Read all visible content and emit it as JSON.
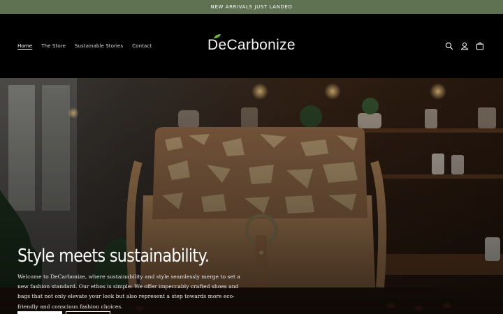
{
  "announcement": {
    "text": "NEW ARRIVALS JUST LANDED"
  },
  "header": {
    "nav": [
      {
        "label": "Home",
        "active": true
      },
      {
        "label": "The Store"
      },
      {
        "label": "Sustainable Stories"
      },
      {
        "label": "Contact"
      }
    ],
    "logo": {
      "part1": "De",
      "part2": "Carbonize"
    },
    "icons": [
      "search-icon",
      "account-icon",
      "cart-icon"
    ]
  },
  "hero": {
    "title": "Style meets sustainability.",
    "description": "Welcome to DeCarbonize, where sustainability and style seamlessly merge to set a new fashion standard. Our ethos is simple: We offer impeccably crafted shoes and bags that not only elevate your look but also represent a step towards more eco-friendly and conscious fashion choices."
  },
  "colors": {
    "announcement_bg": "#5f7353",
    "header_bg": "#000000",
    "accent_leaf": "#6fb23f"
  }
}
